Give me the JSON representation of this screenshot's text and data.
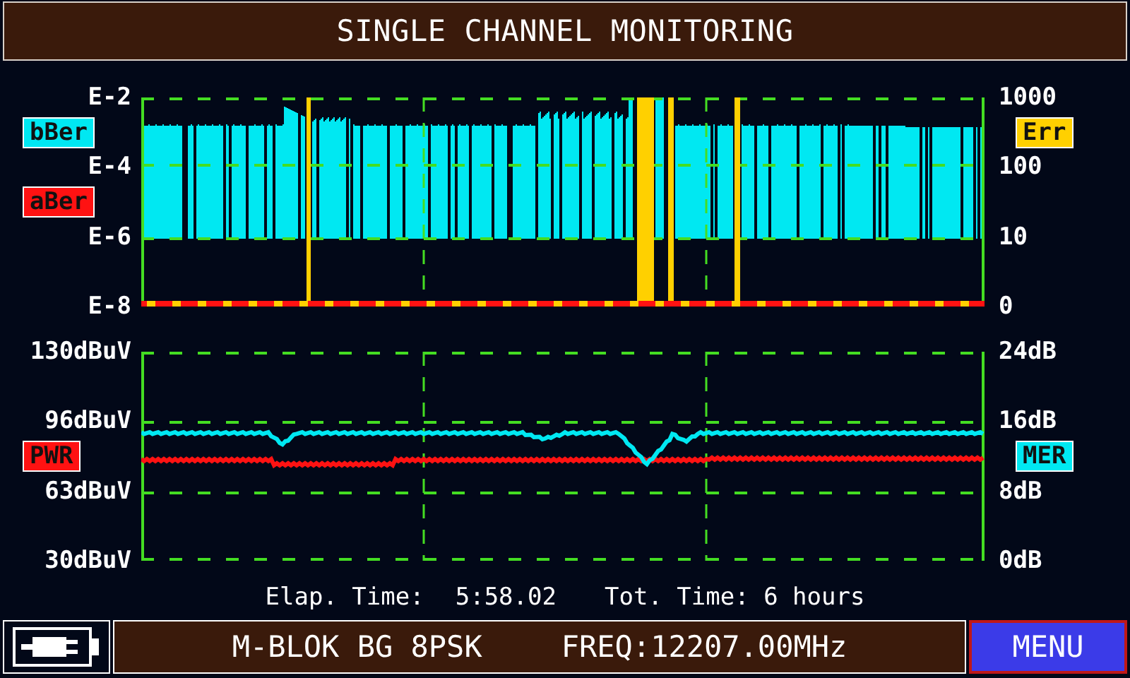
{
  "title": "SINGLE CHANNEL MONITORING",
  "charts": [
    {
      "kind": "ber",
      "left_axis": [
        {
          "kind": "tick",
          "text": "E-2"
        },
        {
          "kind": "legend",
          "text": "bBer",
          "color": "#00e8f2"
        },
        {
          "kind": "tick",
          "text": "E-4"
        },
        {
          "kind": "legend",
          "text": "aBer",
          "color": "#ff1212"
        },
        {
          "kind": "tick",
          "text": "E-6"
        },
        {
          "kind": "tick",
          "text": "E-8"
        }
      ],
      "right_axis": [
        {
          "kind": "tick",
          "text": "1000"
        },
        {
          "kind": "legend",
          "text": "Err",
          "color": "#ffd000"
        },
        {
          "kind": "tick",
          "text": "100"
        },
        {
          "kind": "tick",
          "text": "10"
        },
        {
          "kind": "tick",
          "text": "0"
        }
      ]
    },
    {
      "kind": "level",
      "left_axis": [
        {
          "kind": "tick",
          "text": "130dBuV"
        },
        {
          "kind": "tick",
          "text": "96dBuV"
        },
        {
          "kind": "legend",
          "text": "PWR",
          "color": "#ff1212"
        },
        {
          "kind": "tick",
          "text": "63dBuV"
        },
        {
          "kind": "tick",
          "text": "30dBuV"
        }
      ],
      "right_axis": [
        {
          "kind": "tick",
          "text": "24dB"
        },
        {
          "kind": "tick",
          "text": "16dB"
        },
        {
          "kind": "legend",
          "text": "MER",
          "color": "#00e8f2"
        },
        {
          "kind": "tick",
          "text": "8dB"
        },
        {
          "kind": "tick",
          "text": "0dB"
        }
      ]
    }
  ],
  "status": {
    "elapsed_label": "Elap. Time:",
    "elapsed": "5:58.02",
    "total": "Tot. Time: 6 hours"
  },
  "footer": {
    "channel": "M-BLOK BG 8PSK",
    "frequency": "FREQ:12207.00MHz",
    "menu": "MENU"
  }
}
